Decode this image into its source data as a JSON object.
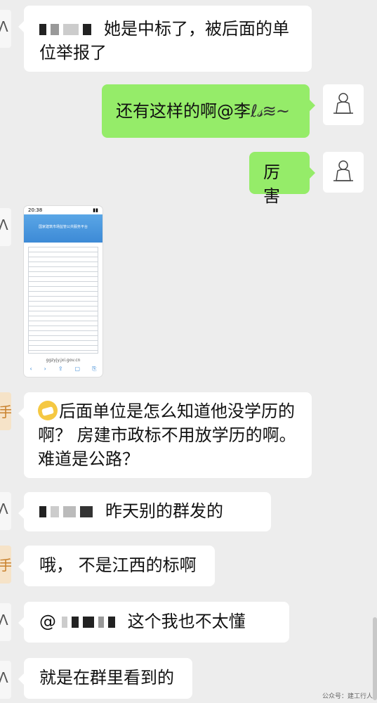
{
  "messages": [
    {
      "side": "left",
      "redacted_prefix": true,
      "text": "她是中标了，被后面的单位举报了"
    },
    {
      "side": "right",
      "text": "还有这样的啊@李",
      "name_flourish": "ℓ𝓈≋~"
    },
    {
      "side": "right",
      "text": "厉害"
    },
    {
      "side": "left",
      "kind": "image",
      "status_time": "20:38",
      "banner": "国家建筑市场监管公共服务平台",
      "url": "ggzyjy.jxi.gov.cn"
    },
    {
      "side": "left",
      "text": "后面单位是怎么知道他没学历的啊？ 房建市政标不用放学历的啊。难道是公路？",
      "emoji": "face-with-bandage"
    },
    {
      "side": "left",
      "redacted_prefix": true,
      "text": "昨天别的群发的"
    },
    {
      "side": "left",
      "text": "哦，  不是江西的标啊"
    },
    {
      "side": "left",
      "at_mention": "@",
      "redacted_prefix": true,
      "text": "这个我也不太懂"
    },
    {
      "side": "left",
      "text": "就是在群里看到的"
    }
  ],
  "avatar_left_glyph": "手",
  "watermark": "公众号：建工行人"
}
